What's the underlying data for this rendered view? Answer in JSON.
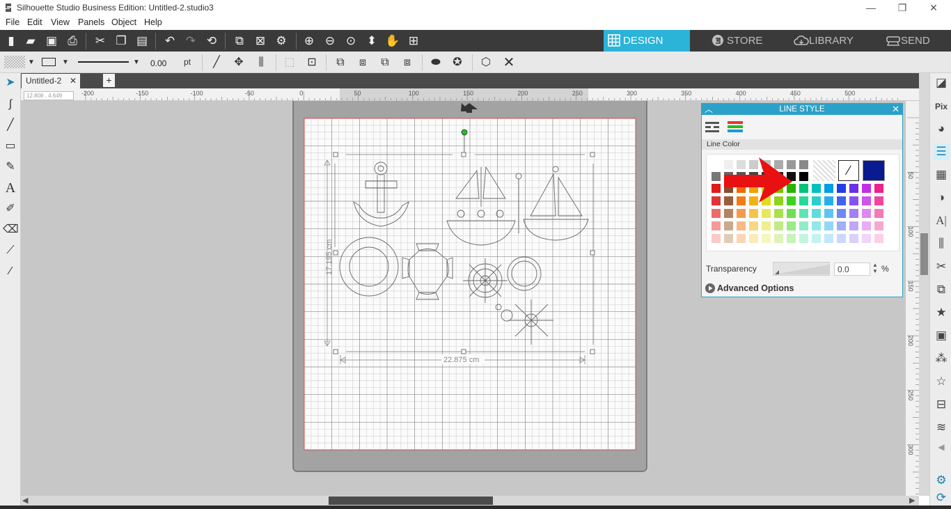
{
  "window": {
    "title": "Silhouette Studio Business Edition: Untitled-2.studio3",
    "minimize": "—",
    "restore": "❐",
    "close": "✕"
  },
  "menu": [
    "File",
    "Edit",
    "View",
    "Panels",
    "Object",
    "Help"
  ],
  "nav": {
    "design": "DESIGN",
    "store": "STORE",
    "library": "LIBRARY",
    "send": "SEND",
    "active_color": "#2bb3d8"
  },
  "line_props": {
    "width_value": "0.00",
    "unit": "pt"
  },
  "doc_tab": {
    "name": "Untitled-2",
    "close": "✕",
    "add": "+"
  },
  "coord_readout": "12.808 , 4.649",
  "ruler": {
    "h_labels": [
      "-200",
      "-150",
      "-100",
      "-50",
      "0",
      "50",
      "100",
      "150",
      "200",
      "250",
      "300",
      "350",
      "400",
      "450",
      "500"
    ],
    "v_labels": [
      "50",
      "100",
      "150",
      "200",
      "250",
      "300"
    ]
  },
  "design": {
    "height_dim": "17.195 cm",
    "width_dim": "22.875 cm"
  },
  "line_style_panel": {
    "title": "LINE STYLE",
    "section": "Line Color",
    "transparency_label": "Transparency",
    "transparency_value": "0.0",
    "transparency_unit": "%",
    "advanced": "Advanced Options",
    "accent": "#2ba1c9",
    "selected_swatch": "#0a1a8f",
    "grays": [
      "#ffffff",
      "#eeeeee",
      "#dddddd",
      "#cccccc",
      "#bbbbbb",
      "#aaaaaa",
      "#999999",
      "#888888"
    ],
    "grays2": [
      "#777777",
      "#666666",
      "#555555",
      "#444444",
      "#333333",
      "#222222",
      "#111111",
      "#000000"
    ],
    "palette": [
      [
        "#e01b1b",
        "#8b4a2b",
        "#f06a00",
        "#f0a000",
        "#d7d200",
        "#7ac000",
        "#27b400",
        "#00c47a",
        "#00c0c0",
        "#009ee6",
        "#2340e6",
        "#6a30e6",
        "#c030e6",
        "#f0208c"
      ],
      [
        "#e03535",
        "#9b5c38",
        "#f27d17",
        "#f2b017",
        "#dede1f",
        "#8fd31f",
        "#3dd21f",
        "#27d89a",
        "#27cfcf",
        "#27aeee",
        "#4461ee",
        "#8753ee",
        "#cf53ee",
        "#f2449f"
      ],
      [
        "#ef6b6b",
        "#b5835e",
        "#f49b4b",
        "#f4c44b",
        "#e8e85a",
        "#a9e14f",
        "#6ee04f",
        "#5fe4b5",
        "#5fdddd",
        "#5fc3f3",
        "#7088f3",
        "#a47ff3",
        "#df86f3",
        "#f579b8"
      ],
      [
        "#f59b9b",
        "#cba98a",
        "#f7b982",
        "#f7d782",
        "#efef8d",
        "#c3ea86",
        "#9aea86",
        "#92ecca",
        "#92e8e8",
        "#92d6f6",
        "#9fb0f6",
        "#bfa6f6",
        "#e8adf6",
        "#f7a7cf"
      ],
      [
        "#fac9c9",
        "#e1cdb7",
        "#fad6b7",
        "#faebb7",
        "#f6f6c0",
        "#ddf3ba",
        "#c6f3ba",
        "#c3f5e0",
        "#c3f2f2",
        "#c3e8fb",
        "#ccd7fb",
        "#dbcffb",
        "#f2d3fb",
        "#fbd0e6"
      ]
    ]
  }
}
